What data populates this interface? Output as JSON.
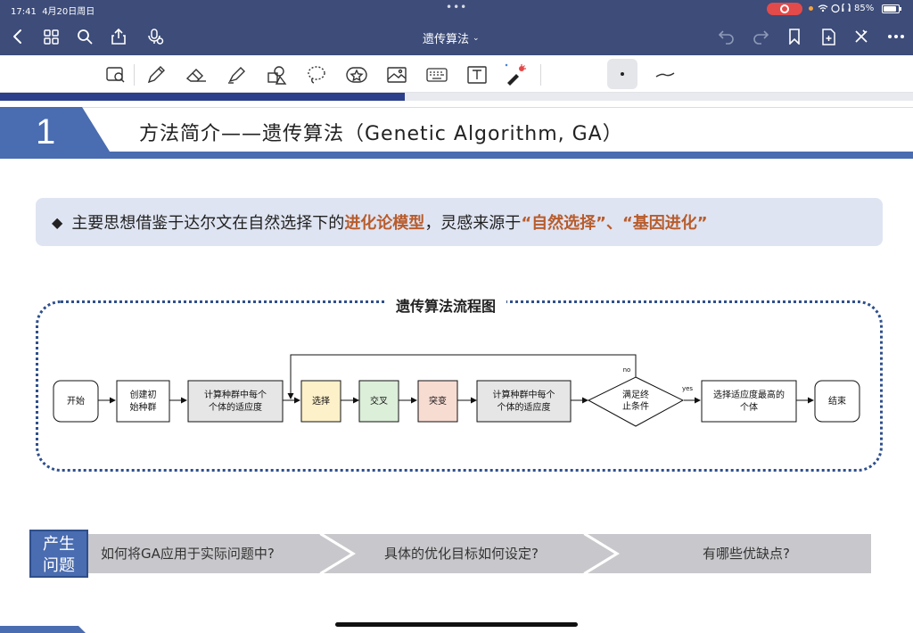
{
  "status_bar": {
    "time": "17:41",
    "date": "4月20日周日",
    "battery": "85%"
  },
  "nav": {
    "doc_title": "遗传算法"
  },
  "slide": {
    "number": "1",
    "title": "方法简介——遗传算法（Genetic Algorithm, GA）",
    "idea": {
      "prefix": "主要思想借鉴于达尔文在自然选择下的",
      "highlight1": "进化论模型",
      "middle": "，灵感来源于",
      "highlight2": "“自然选择”、“基因进化”"
    },
    "flowchart": {
      "title": "遗传算法流程图",
      "nodes": {
        "start": "开始",
        "create_1": "创建初",
        "create_2": "始种群",
        "fitness_a_1": "计算种群中每个",
        "fitness_a_2": "个体的适应度",
        "select": "选择",
        "crossover": "交叉",
        "mutation": "突变",
        "fitness_b_1": "计算种群中每个",
        "fitness_b_2": "个体的适应度",
        "condition_1": "满足终",
        "condition_2": "止条件",
        "best_1": "选择适应度最高的",
        "best_2": "个体",
        "end": "结束"
      },
      "edge_labels": {
        "no": "no",
        "yes": "yes"
      }
    },
    "problems": {
      "label_1": "产生",
      "label_2": "问题",
      "q1": "如何将GA应用于实际问题中?",
      "q2": "具体的优化目标如何设定?",
      "q3": "有哪些优缺点?"
    }
  },
  "colors": {
    "chrome": "#3d4c79",
    "accent_blue": "#4a6cb0",
    "highlight_orange": "#b85c2c",
    "select_fill": "#fdf1c9",
    "crossover_fill": "#dcefd9",
    "mutation_fill": "#f7dcd2",
    "fitness_fill": "#e6e6e6"
  }
}
